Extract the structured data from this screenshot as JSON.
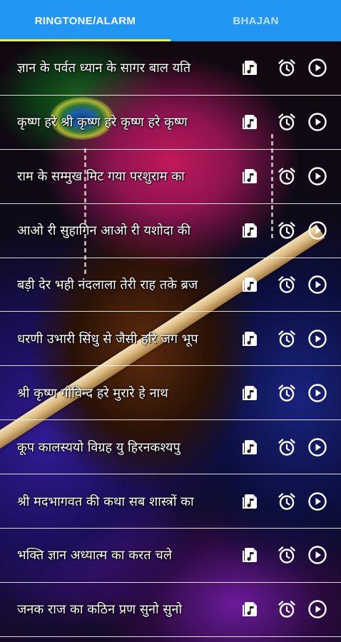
{
  "tabs": [
    {
      "label": "RINGTONE/ALARM",
      "active": true
    },
    {
      "label": "BHAJAN",
      "active": false
    }
  ],
  "colors": {
    "tab_bar": "#2196f3",
    "tab_indicator": "#ffeb3b",
    "text": "#ffffff"
  },
  "icons": {
    "ringtone": "music-file-icon",
    "alarm": "alarm-clock-icon",
    "play": "play-circle-icon"
  },
  "songs": [
    {
      "title": "ज्ञान के पर्वत ध्यान के सागर बाल यति"
    },
    {
      "title": "कृष्ण हरे श्री कृष्ण हरे कृष्ण हरे कृष्ण"
    },
    {
      "title": "राम के सम्मुख मिट गया परशुराम का"
    },
    {
      "title": "आओ री सुहागिन आओ री यशोदा की"
    },
    {
      "title": "बड़ी देर भही नंदलाला तेरी राह तके ब्रज"
    },
    {
      "title": "धरणी उभारी सिंधु से जैसी हरि जग भूप"
    },
    {
      "title": "श्री  कृष्ण  गोविन्द  हरे  मुरारे हे  नाथ"
    },
    {
      "title": "कूप कालस्ययो विग्रह यु हिरनकश्यपु"
    },
    {
      "title": "श्री मदभागवत की कथा सब शास्त्रों का"
    },
    {
      "title": "भक्ति ज्ञान अध्यात्म का करत चले"
    },
    {
      "title": "जनक राज का कठिन प्रण सुनो सुनो"
    }
  ]
}
